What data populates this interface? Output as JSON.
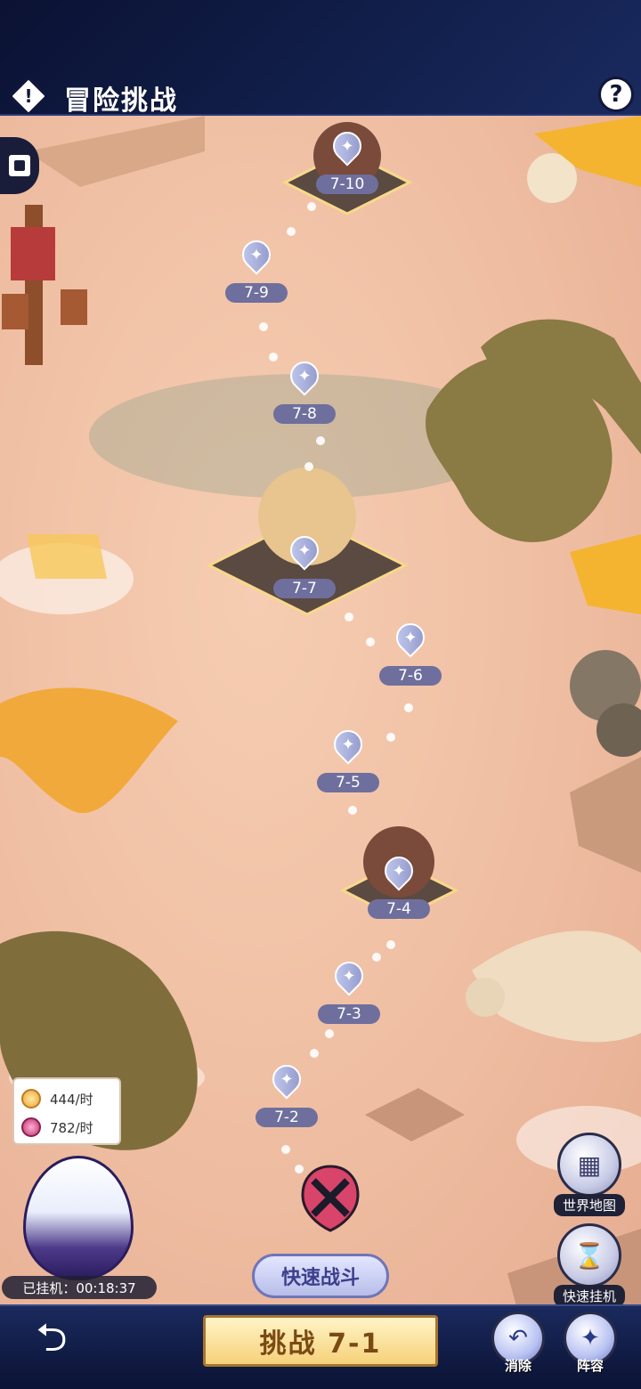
{
  "header": {
    "info_icon": "exclamation-diamond-icon",
    "info_symbol": "!",
    "title": "冒险挑战",
    "help_icon": "question-icon",
    "help_symbol": "?"
  },
  "stages": [
    {
      "id": "7-10",
      "label": "7-10",
      "type": "boss"
    },
    {
      "id": "7-9",
      "label": "7-9",
      "type": "normal"
    },
    {
      "id": "7-8",
      "label": "7-8",
      "type": "normal"
    },
    {
      "id": "7-7",
      "label": "7-7",
      "type": "boss"
    },
    {
      "id": "7-6",
      "label": "7-6",
      "type": "normal"
    },
    {
      "id": "7-5",
      "label": "7-5",
      "type": "normal"
    },
    {
      "id": "7-4",
      "label": "7-4",
      "type": "boss"
    },
    {
      "id": "7-3",
      "label": "7-3",
      "type": "normal"
    },
    {
      "id": "7-2",
      "label": "7-2",
      "type": "normal"
    }
  ],
  "income": {
    "gold_rate": "444/时",
    "exp_rate": "782/时"
  },
  "afk_timer": "已挂机：00:18:37",
  "quick_battle_label": "快速战斗",
  "side_buttons": {
    "world_map": "世界地图",
    "quick_afk": "快速挂机"
  },
  "bottom": {
    "challenge_label": "挑战 7-1",
    "clear_label": "消除",
    "lineup_label": "阵容"
  },
  "colors": {
    "header_bg": "#0e1636",
    "map_bg": "#efbea2",
    "stage_label_bg": "#6f6f9e",
    "challenge_btn": "#f6d17a"
  }
}
